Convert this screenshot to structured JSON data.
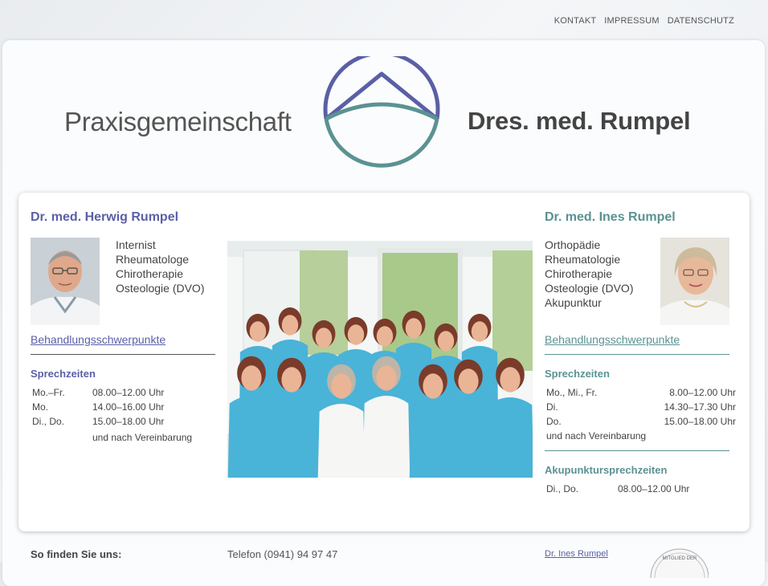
{
  "nav": {
    "items": [
      "KONTAKT",
      "IMPRESSUM",
      "DATENSCHUTZ"
    ]
  },
  "brand": {
    "left": "Praxisgemeinschaft",
    "right": "Dres. med. Rumpel"
  },
  "doctor_left": {
    "name": "Dr. med. Herwig Rumpel",
    "specialties": [
      "Internist",
      "Rheumatologe",
      "Chirotherapie",
      "Osteologie (DVO)"
    ],
    "link": "Behandlungsschwerpunkte",
    "hours_title": "Sprechzeiten",
    "hours": [
      {
        "day": "Mo.–Fr.",
        "time": "08.00–12.00 Uhr"
      },
      {
        "day": "Mo.",
        "time": "14.00–16.00 Uhr"
      },
      {
        "day": "Di., Do.",
        "time": "15.00–18.00 Uhr"
      }
    ],
    "hours_note": "und nach Vereinbarung"
  },
  "doctor_right": {
    "name": "Dr. med. Ines Rumpel",
    "specialties": [
      "Orthopädie",
      "Rheumatologie",
      "Chirotherapie",
      "Osteologie (DVO)",
      "Akupunktur"
    ],
    "link": "Behandlungsschwerpunkte",
    "hours_title": "Sprechzeiten",
    "hours": [
      {
        "day": "Mo., Mi., Fr.",
        "time": "8.00–12.00 Uhr"
      },
      {
        "day": "Di.",
        "time": "14.30–17.30 Uhr"
      },
      {
        "day": "Do.",
        "time": "15.00–18.00 Uhr"
      }
    ],
    "hours_note": "und nach Vereinbarung",
    "acu_title": "Akupunktursprechzeiten",
    "acu_hours": [
      {
        "day": "Di., Do.",
        "time": "08.00–12.00 Uhr"
      }
    ]
  },
  "footer": {
    "label": "So finden Sie uns:",
    "phone": "Telefon (0941) 94 97 47",
    "link": "Dr. Ines Rumpel",
    "badge_text": "MITGLIED DER"
  },
  "colors": {
    "purple": "#5a5fa6",
    "teal": "#5b9292",
    "shirt": "#4ab3d8"
  },
  "icons": {
    "logo": "mountain-circle-logo"
  }
}
